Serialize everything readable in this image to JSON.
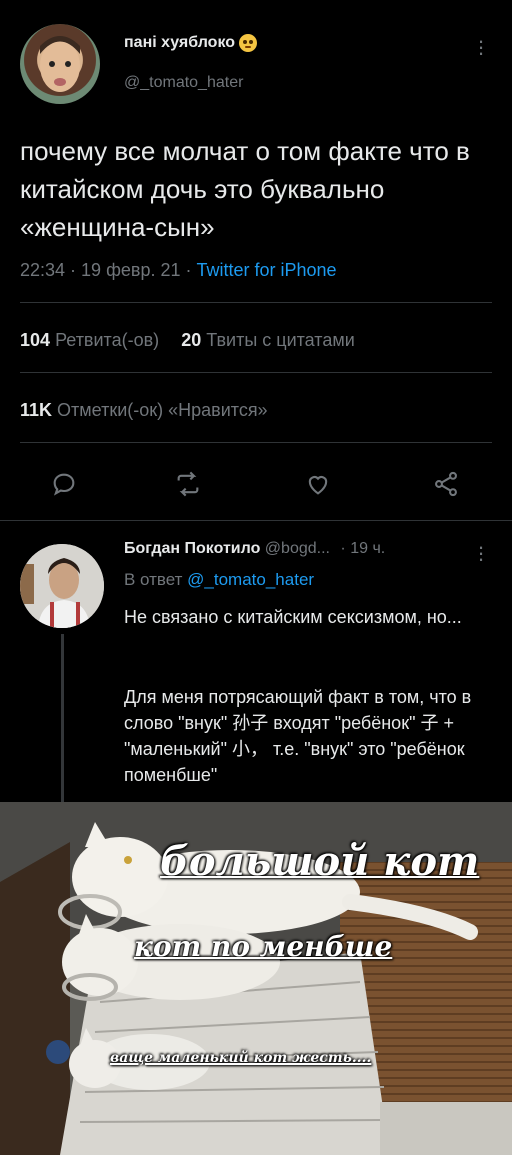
{
  "tweet": {
    "display_name": "пані хуяблоко",
    "handle": "@_tomato_hater",
    "text": "почему все молчат о том факте что в китайском дочь это буквально «женщина-сын»",
    "time": "22:34 · 19 февр. 21 · ",
    "source": "Twitter for iPhone",
    "retweets_count": "104",
    "retweets_label": "Ретвита(-ов)",
    "quotes_count": "20",
    "quotes_label": "Твиты с цитатами",
    "likes_count": "11K",
    "likes_label": "Отметки(-ок) «Нравится»"
  },
  "reply": {
    "display_name": "Богдан Покотило",
    "handle": "@bogd...",
    "time": "· 19 ч.",
    "reply_to_prefix": "В ответ ",
    "reply_to_handle": "@_tomato_hater",
    "line1": "Не связано с китайским сексизмом, но...",
    "line2": "Для меня потрясающий факт в том, что в слово \"внук\" 孙子 входят \"ребёнок\" 子 + \"маленький\" 小， т.е. \"внук\" это \"ребёнок поменбше\""
  },
  "meme": {
    "big_cat": "большой кот",
    "medium_cat": "кот по менбше",
    "small_cat": "ваще маленький кот жесть...."
  },
  "icons": {
    "reply": "reply-icon",
    "retweet": "retweet-icon",
    "like": "heart-icon",
    "share": "share-icon",
    "more": "more-icon"
  },
  "colors": {
    "background": "#000000",
    "accent": "#1d9bf0",
    "muted": "#71767b"
  }
}
